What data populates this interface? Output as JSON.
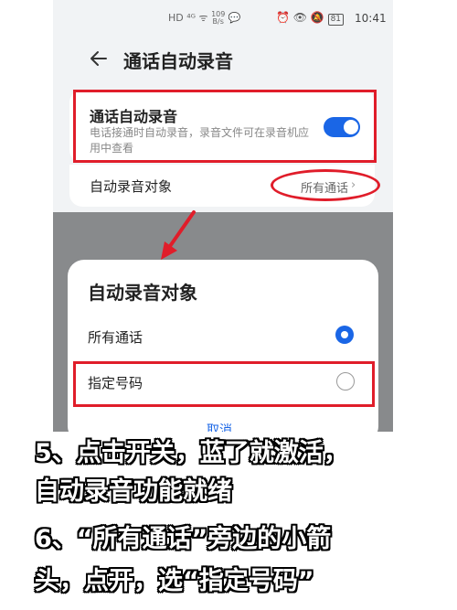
{
  "status_bar": {
    "left_icons": "HD ⁴ᴳ ᯤ",
    "speed_value": "109",
    "speed_unit": "B/s",
    "right_icons": "⏰ 👁 🔕",
    "battery": "81",
    "time": "10:41"
  },
  "header": {
    "title": "通话自动录音",
    "back_icon": "back-arrow-icon"
  },
  "settings": {
    "auto_record": {
      "title": "通话自动录音",
      "description": "电话接通时自动录音，录音文件可在录音机应用中查看",
      "enabled": true
    },
    "record_target": {
      "label": "自动录音对象",
      "value": "所有通话"
    }
  },
  "dialog": {
    "title": "自动录音对象",
    "options": [
      {
        "label": "所有通话",
        "selected": true
      },
      {
        "label": "指定号码",
        "selected": false
      }
    ],
    "cancel": "取消"
  },
  "captions": {
    "line1": "5、点击开关，蓝了就激活，",
    "line2": "自动录音功能就绪",
    "line3": "6、“所有通话”旁边的小箭",
    "line4": "头，点开，选“指定号码”"
  },
  "colors": {
    "accent": "#1a66e6",
    "highlight": "#e01d2a"
  }
}
